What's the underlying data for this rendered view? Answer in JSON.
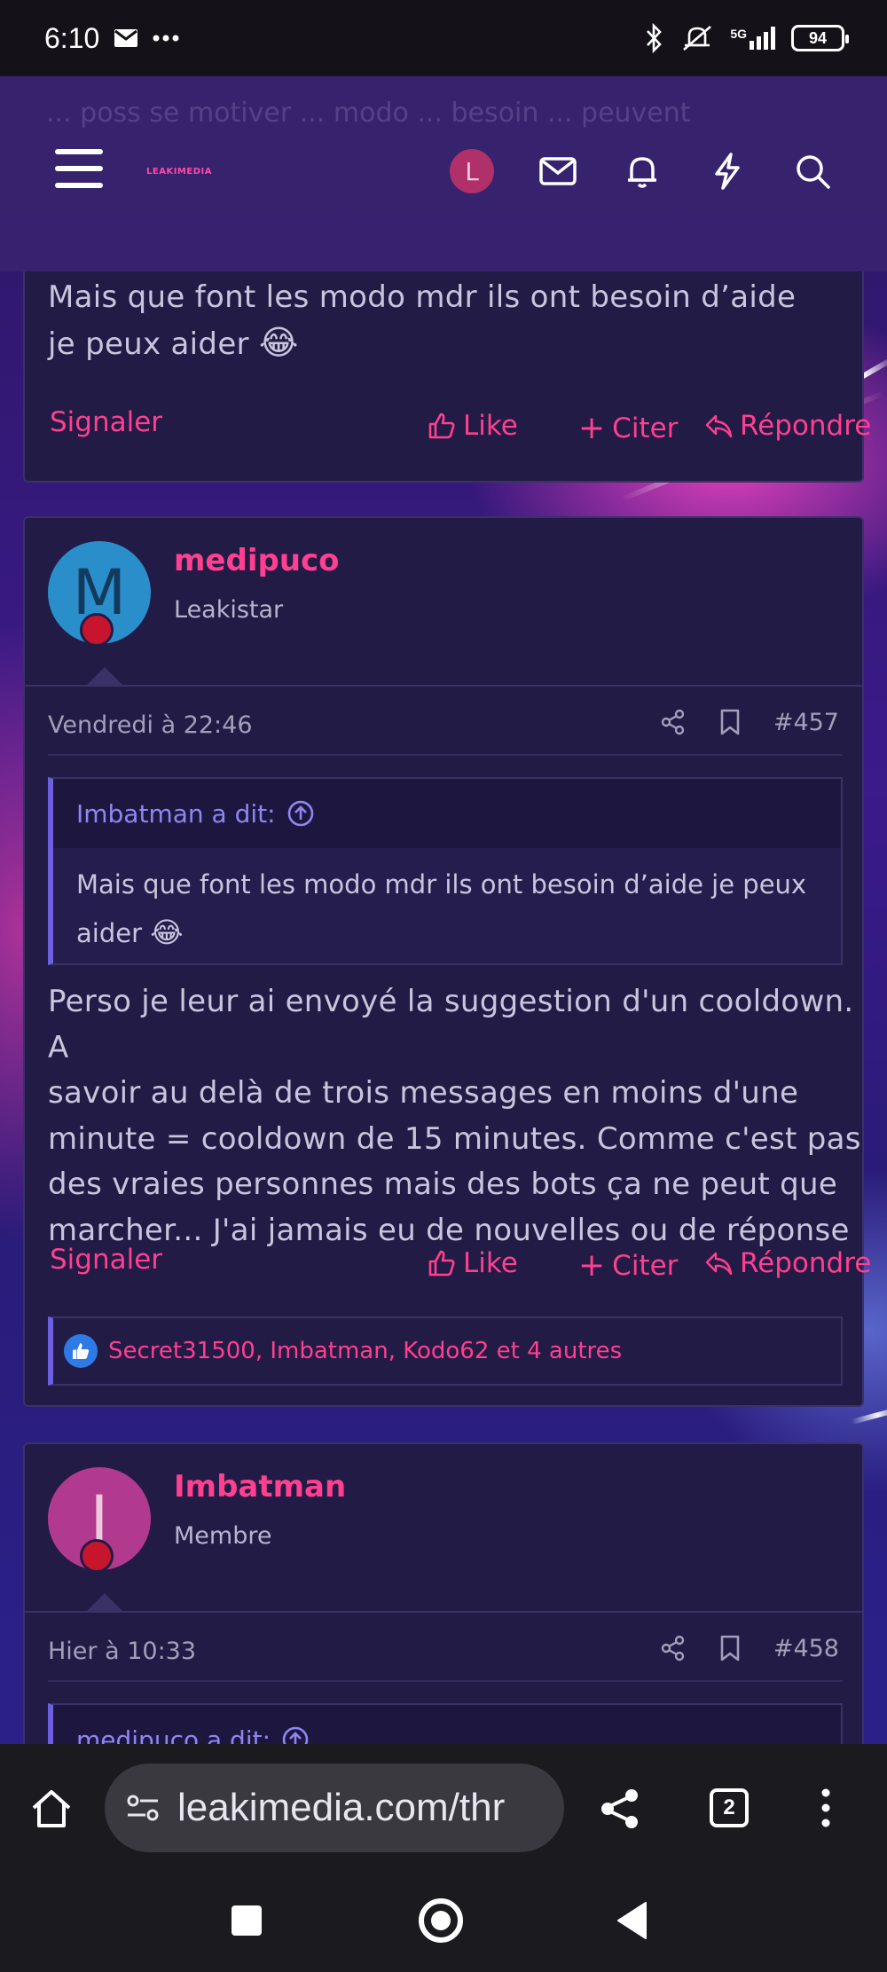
{
  "status_bar": {
    "time": "6:10",
    "network": "5G",
    "battery": "94"
  },
  "header": {
    "logo": "LEAKIMEDIA",
    "avatar_letter": "L",
    "ghost_text": "... poss se motiver ... modo ... besoin ... peuvent"
  },
  "post_prev": {
    "body": "Mais que font les modo mdr ils ont besoin d’aide je peux aider",
    "emoji": "😂",
    "actions": {
      "report": "Signaler",
      "like": "Like",
      "quote": "Citer",
      "reply": "Répondre"
    }
  },
  "post_457": {
    "avatar_letter": "M",
    "avatar_color": "#2a8ecb",
    "username": "medipuco",
    "role": "Leakistar",
    "date": "Vendredi à 22:46",
    "number": "#457",
    "quote_author": "Imbatman a dit:",
    "quote_text": "Mais que font les modo mdr ils ont besoin d’aide je peux aider",
    "quote_emoji": "😂",
    "body_lines": [
      "Perso je leur ai envoyé la suggestion d'un cooldown. A",
      "savoir au delà de trois messages en moins d'une",
      "minute = cooldown de 15 minutes. Comme c'est pas",
      "des vraies personnes mais des bots ça ne peut que",
      "marcher... J'ai jamais eu de nouvelles ou de réponse"
    ],
    "actions": {
      "report": "Signaler",
      "like": "Like",
      "quote": "Citer",
      "reply": "Répondre"
    },
    "reactions": "Secret31500, Imbatman, Kodo62 et 4 autres"
  },
  "post_458": {
    "avatar_letter": "I",
    "avatar_color": "#b23a8e",
    "username": "Imbatman",
    "role": "Membre",
    "date": "Hier à 10:33",
    "number": "#458",
    "quote_author": "medipuco a dit:"
  },
  "browser": {
    "url": "leakimedia.com/thr",
    "tab_count": "2"
  },
  "colors": {
    "accent": "#ff3f8f",
    "card": "#211b45",
    "quote_accent": "#6c5fe0"
  }
}
